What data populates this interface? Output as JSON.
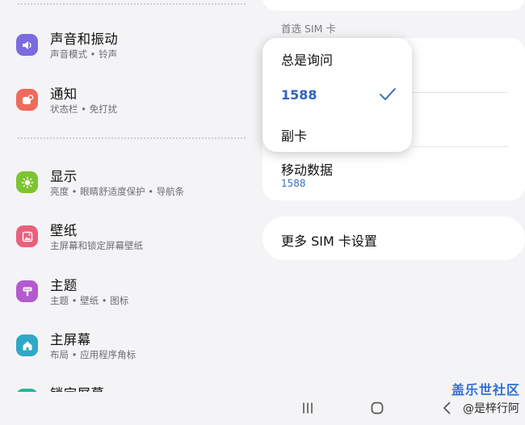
{
  "left_list": {
    "items": [
      {
        "title": "声音和振动",
        "subtitle": "声音模式 • 铃声",
        "icon": "volume-icon",
        "color": "#7b6be0"
      },
      {
        "title": "通知",
        "subtitle": "状态栏 • 免打扰",
        "icon": "notification-icon",
        "color": "#ef6b5b"
      },
      {
        "title": "显示",
        "subtitle": "亮度 • 眼睛舒适度保护 • 导航条",
        "icon": "sun-icon",
        "color": "#7dc430"
      },
      {
        "title": "壁纸",
        "subtitle": "主屏幕和锁定屏幕壁纸",
        "icon": "image-icon",
        "color": "#ea5f7d"
      },
      {
        "title": "主题",
        "subtitle": "主题 • 壁纸 • 图标",
        "icon": "theme-brush-icon",
        "color": "#b45ad0"
      },
      {
        "title": "主屏幕",
        "subtitle": "布局 • 应用程序角标",
        "icon": "home-icon",
        "color": "#2fa8c8"
      },
      {
        "title": "锁定屏幕",
        "subtitle": "",
        "icon": "lock-icon",
        "color": "#2bb39e"
      }
    ]
  },
  "sim": {
    "section_header": "首选 SIM 卡",
    "mobile_data_label": "移动数据",
    "mobile_data_value": "1588",
    "more_settings_label": "更多 SIM 卡设置"
  },
  "popup": {
    "options": [
      {
        "label": "总是询问",
        "selected": false
      },
      {
        "label": "1588",
        "selected": true
      },
      {
        "label": "副卡",
        "selected": false
      }
    ]
  },
  "navbar": {
    "recents_icon": "recents-icon",
    "home_icon": "home-button-icon",
    "back_icon": "back-icon"
  },
  "watermark": {
    "title": "盖乐世社区",
    "subtitle": "@是梓行阿"
  },
  "colors": {
    "accent_blue": "#2f63c0",
    "background": "#f4f4f6",
    "card": "#ffffff"
  }
}
